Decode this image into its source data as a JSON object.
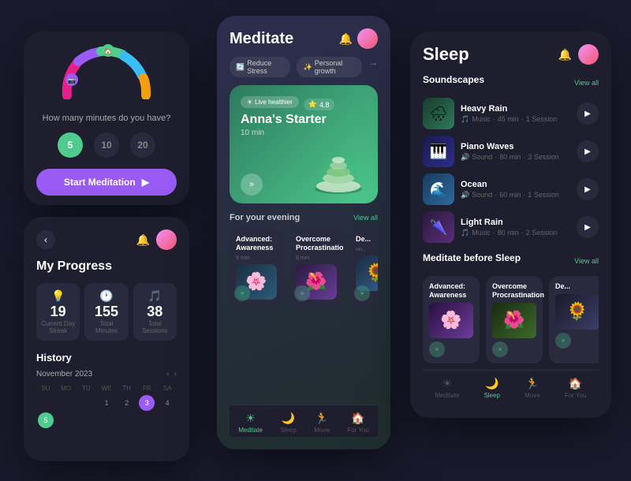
{
  "app": {
    "bg_color": "#1a1a2e"
  },
  "left_card": {
    "question": "How many minutes do you have?",
    "time_options": [
      {
        "value": "5",
        "active": true
      },
      {
        "value": "10",
        "active": false
      },
      {
        "value": "20",
        "active": false
      }
    ],
    "start_btn_label": "Start Meditation"
  },
  "progress_card": {
    "title": "My Progress",
    "stats": [
      {
        "icon": "💡",
        "value": "19",
        "label": "Current Day Streak"
      },
      {
        "icon": "🕐",
        "value": "155",
        "label": "Total Minutes"
      },
      {
        "icon": "🎵",
        "value": "38",
        "label": "Total Sessions"
      }
    ],
    "history_title": "History",
    "month": "November 2023",
    "calendar": {
      "headers": [
        "SU",
        "MO",
        "TU",
        "WE",
        "TH",
        "FR",
        "SA"
      ],
      "days": [
        "",
        "",
        "",
        "1",
        "2",
        "3",
        "4",
        "5",
        ""
      ]
    }
  },
  "meditate_card": {
    "title": "Meditate",
    "tags": [
      {
        "icon": "🔄",
        "label": "Reduce Stress"
      },
      {
        "icon": "✨",
        "label": "Personal growth"
      }
    ],
    "feature": {
      "live_label": "Live healthier",
      "rating": "4.8",
      "title": "Anna's Starter",
      "subtitle": "10 min"
    },
    "section_label": "For your evening",
    "view_all": "View all",
    "mini_cards": [
      {
        "title": "Advanced: Awareness",
        "sub": "5 min"
      },
      {
        "title": "Overcome Procrastination",
        "sub": "8 min"
      },
      {
        "title": "De...",
        "sub": "un..."
      }
    ],
    "nav_items": [
      {
        "icon": "☀",
        "label": "Meditate",
        "active": true
      },
      {
        "icon": "🌙",
        "label": "Sleep",
        "active": false
      },
      {
        "icon": "🏃",
        "label": "Move",
        "active": false
      },
      {
        "icon": "🏠",
        "label": "For You",
        "active": false
      }
    ]
  },
  "sleep_card": {
    "title": "Sleep",
    "soundscapes_title": "Soundscapes",
    "view_all": "View all",
    "sounds": [
      {
        "name": "Heavy Rain",
        "type": "Music",
        "duration": "45 min",
        "sessions": "1 Session",
        "thumb_class": "sound-thumb-heavy",
        "thumb_emoji": "🌧"
      },
      {
        "name": "Piano Waves",
        "type": "Sound",
        "duration": "80 min",
        "sessions": "3 Session",
        "thumb_class": "sound-thumb-piano",
        "thumb_emoji": "🎹"
      },
      {
        "name": "Ocean",
        "type": "Sound",
        "duration": "60 min",
        "sessions": "1 Session",
        "thumb_class": "sound-thumb-ocean",
        "thumb_emoji": "🌊"
      },
      {
        "name": "Light Rain",
        "type": "Music",
        "duration": "80 min",
        "sessions": "2 Session",
        "thumb_class": "sound-thumb-rain",
        "thumb_emoji": "🌂"
      }
    ],
    "before_sleep_title": "Meditate before Sleep",
    "sleep_mini_cards": [
      {
        "title": "Advanced: Awareness",
        "emoji": "🌸"
      },
      {
        "title": "Overcome Procrastination",
        "emoji": "🌺"
      },
      {
        "title": "De...",
        "emoji": "🌻"
      }
    ],
    "nav_items": [
      {
        "icon": "☀",
        "label": "Meditate",
        "active": false
      },
      {
        "icon": "🌙",
        "label": "Sleep",
        "active": true
      },
      {
        "icon": "🏃",
        "label": "Move",
        "active": false
      },
      {
        "icon": "🏠",
        "label": "For You",
        "active": false
      }
    ]
  }
}
